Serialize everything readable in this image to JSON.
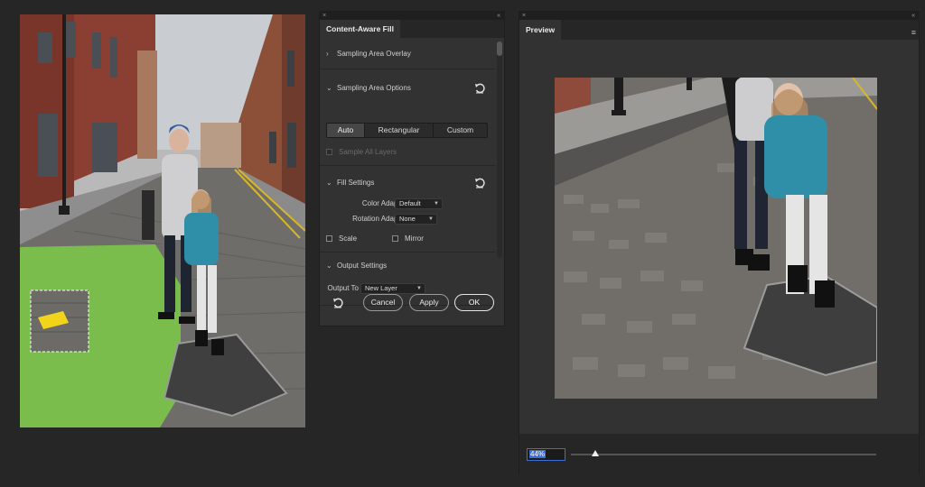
{
  "caf_panel": {
    "close_glyph": "×",
    "collapse_glyph": "«",
    "tab_title": "Content-Aware Fill",
    "sections": {
      "overlay": {
        "label": "Sampling Area Overlay",
        "chevron": "›"
      },
      "sampling_options": {
        "label": "Sampling Area Options",
        "chevron": "⌄"
      },
      "fill_settings": {
        "label": "Fill Settings",
        "chevron": "⌄"
      },
      "output_settings": {
        "label": "Output Settings",
        "chevron": "⌄"
      }
    },
    "sampling_modes": [
      "Auto",
      "Rectangular",
      "Custom"
    ],
    "sampling_mode_selected": "Auto",
    "sample_all_layers": {
      "label": "Sample All Layers",
      "checked": false,
      "disabled": true
    },
    "color_adaptation": {
      "label": "Color Adaptation",
      "value": "Default"
    },
    "rotation_adaptation": {
      "label": "Rotation Adaptation",
      "value": "None"
    },
    "scale": {
      "label": "Scale",
      "checked": false
    },
    "mirror": {
      "label": "Mirror",
      "checked": false
    },
    "output_to": {
      "label": "Output To",
      "value": "New Layer"
    },
    "buttons": {
      "cancel": "Cancel",
      "apply": "Apply",
      "ok": "OK"
    }
  },
  "preview_panel": {
    "close_glyph": "×",
    "collapse_glyph": "«",
    "menu_glyph": "≡",
    "tab_title": "Preview",
    "zoom_value": "44%",
    "zoom_fraction": 0.08
  },
  "icons": {
    "reset": "reset-icon",
    "chevron_right": "chevron-right-icon",
    "chevron_down": "chevron-down-icon",
    "caret": "caret-down-icon"
  },
  "colors": {
    "panel_bg": "#323232",
    "app_bg": "#262626",
    "sampling_overlay": "#7bc44a",
    "selection_yellow": "#f2d51b",
    "zoom_highlight": "#3b6fd8"
  }
}
